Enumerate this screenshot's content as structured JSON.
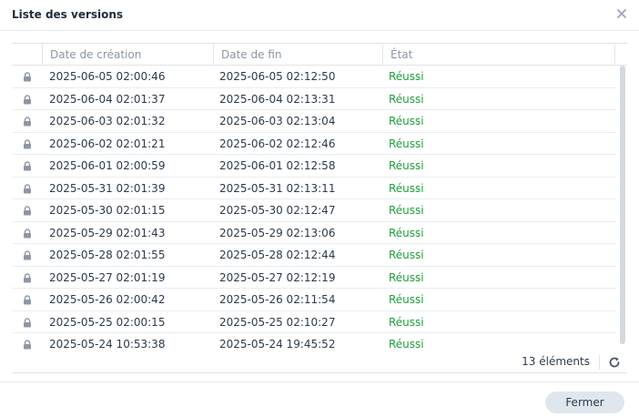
{
  "dialog": {
    "title": "Liste des versions",
    "close_icon": "close-icon"
  },
  "table": {
    "columns": [
      "Date de création",
      "Date de fin",
      "État"
    ],
    "rows": [
      {
        "created": "2025-06-05 02:00:46",
        "ended": "2025-06-05 02:12:50",
        "state": "Réussi",
        "locked": true
      },
      {
        "created": "2025-06-04 02:01:37",
        "ended": "2025-06-04 02:13:31",
        "state": "Réussi",
        "locked": true
      },
      {
        "created": "2025-06-03 02:01:32",
        "ended": "2025-06-03 02:13:04",
        "state": "Réussi",
        "locked": true
      },
      {
        "created": "2025-06-02 02:01:21",
        "ended": "2025-06-02 02:12:46",
        "state": "Réussi",
        "locked": true
      },
      {
        "created": "2025-06-01 02:00:59",
        "ended": "2025-06-01 02:12:58",
        "state": "Réussi",
        "locked": true
      },
      {
        "created": "2025-05-31 02:01:39",
        "ended": "2025-05-31 02:13:11",
        "state": "Réussi",
        "locked": true
      },
      {
        "created": "2025-05-30 02:01:15",
        "ended": "2025-05-30 02:12:47",
        "state": "Réussi",
        "locked": true
      },
      {
        "created": "2025-05-29 02:01:43",
        "ended": "2025-05-29 02:13:06",
        "state": "Réussi",
        "locked": true
      },
      {
        "created": "2025-05-28 02:01:55",
        "ended": "2025-05-28 02:12:44",
        "state": "Réussi",
        "locked": true
      },
      {
        "created": "2025-05-27 02:01:19",
        "ended": "2025-05-27 02:12:19",
        "state": "Réussi",
        "locked": true
      },
      {
        "created": "2025-05-26 02:00:42",
        "ended": "2025-05-26 02:11:54",
        "state": "Réussi",
        "locked": true
      },
      {
        "created": "2025-05-25 02:00:15",
        "ended": "2025-05-25 02:10:27",
        "state": "Réussi",
        "locked": true
      },
      {
        "created": "2025-05-24 10:53:38",
        "ended": "2025-05-24 19:45:52",
        "state": "Réussi",
        "locked": true
      }
    ],
    "lock_icon": "lock-icon"
  },
  "footer": {
    "count_label": "13 éléments",
    "refresh_icon": "refresh-icon",
    "close_button": "Fermer"
  },
  "colors": {
    "success": "#1e9e3b",
    "header_text": "#8a97a4",
    "button_bg": "#dfe6ee"
  }
}
